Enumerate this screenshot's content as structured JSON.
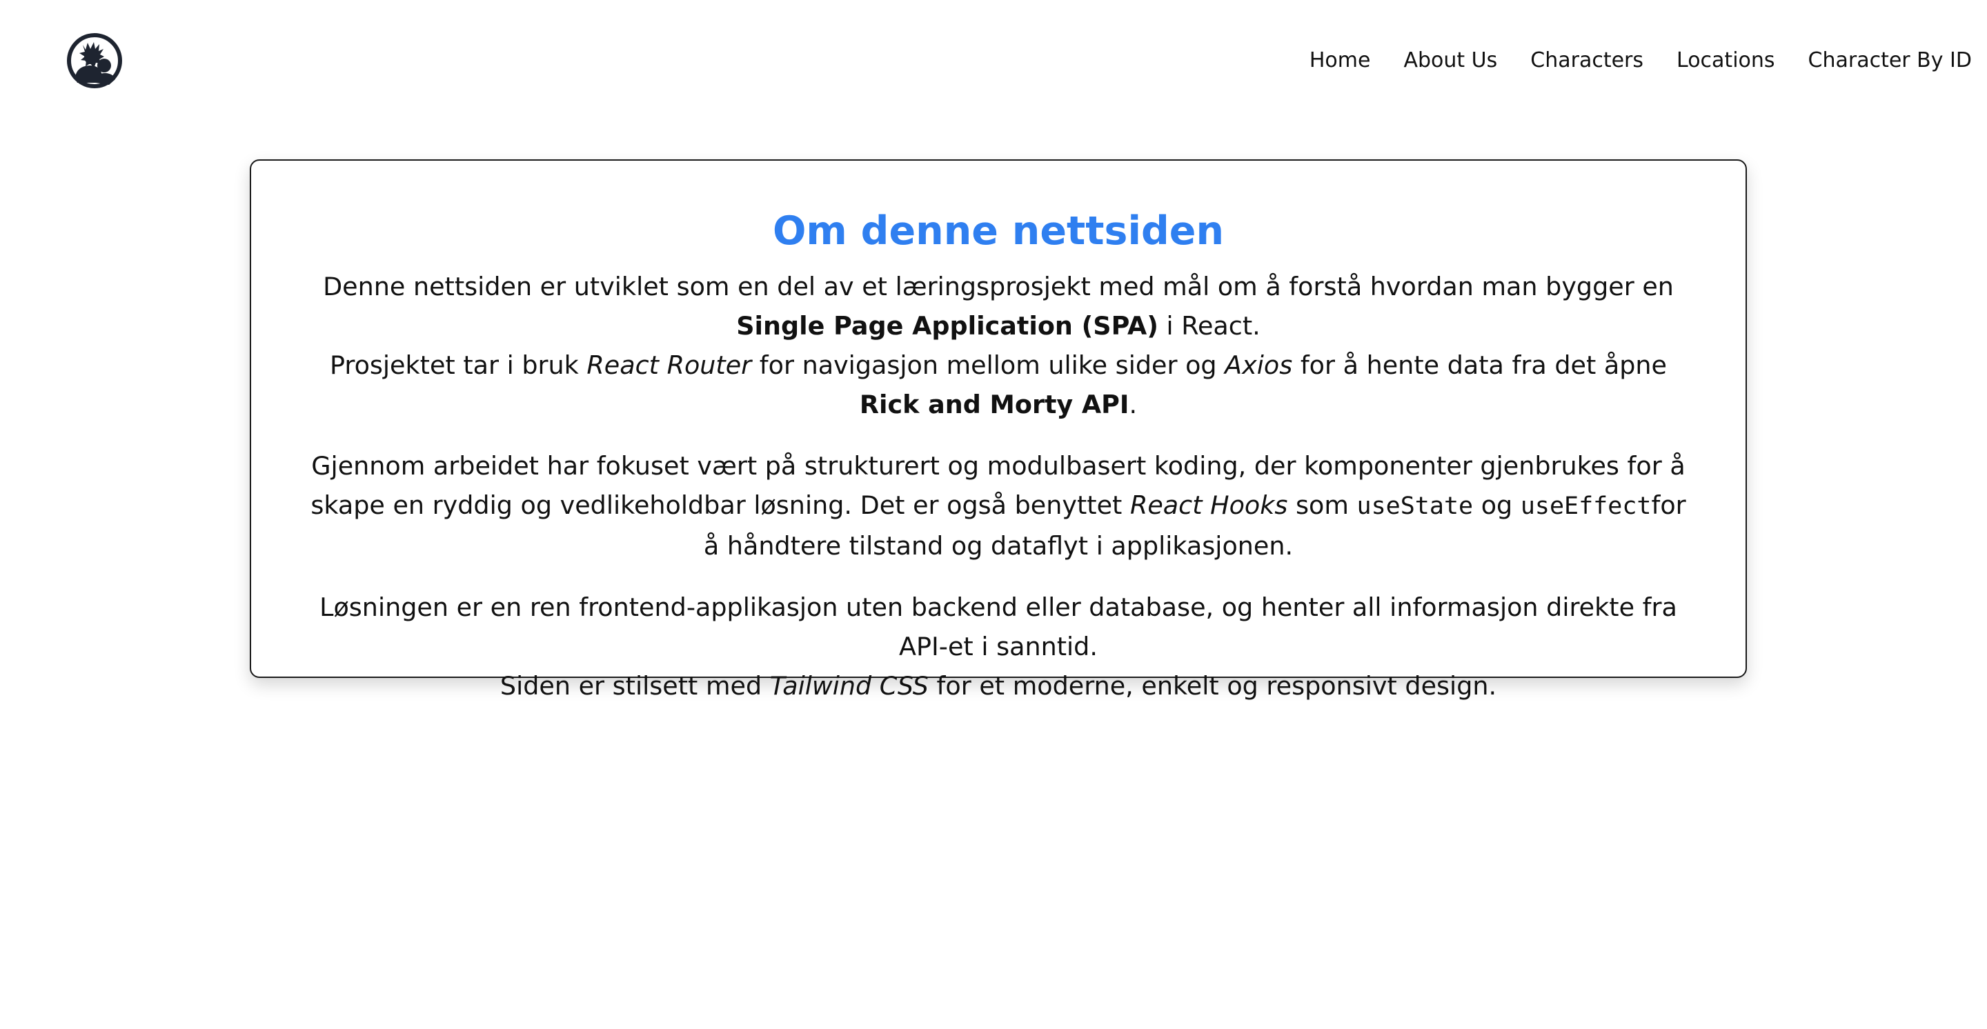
{
  "nav": {
    "logo_icon": "rick-and-morty-silhouette-icon",
    "links": [
      "Home",
      "About Us",
      "Characters",
      "Locations",
      "Character By ID"
    ]
  },
  "about": {
    "title": "Om denne nettsiden",
    "p1": {
      "intro": "Denne nettsiden er utviklet som en del av et læringsprosjekt med mål om å forstå hvordan man bygger en ",
      "spa": "Single Page Application (SPA)",
      "spa_tail": " i React.",
      "router_pre": "Prosjektet tar i bruk ",
      "router": "React Router",
      "router_mid": " for navigasjon mellom ulike sider og ",
      "axios": "Axios",
      "axios_mid": " for å hente data fra det åpne ",
      "api": "Rick and Morty API",
      "end": "."
    },
    "p2": {
      "pre": "Gjennom arbeidet har fokuset vært på strukturert og modulbasert koding, der komponenter gjenbrukes for å skape en ryddig og vedlikeholdbar løsning. Det er også benyttet ",
      "hooks": "React Hooks",
      "som": " som ",
      "usestate": "useState",
      "og": " og ",
      "useeffect": "useEffect",
      "post": "for å håndtere tilstand og dataflyt i applikasjonen."
    },
    "p3": {
      "line1": "Løsningen er en ren frontend-applikasjon uten backend eller database, og henter all informasjon direkte fra API-et i sanntid.",
      "pre": "Siden er stilsett med ",
      "tailwind": "Tailwind CSS",
      "post": " for et moderne, enkelt og responsivt design."
    }
  }
}
